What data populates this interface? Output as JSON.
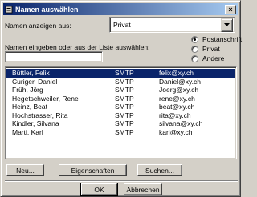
{
  "window": {
    "title": "Namen auswählen",
    "close_symbol": "×"
  },
  "show_names": {
    "label": "Namen anzeigen aus:",
    "selected": "Privat"
  },
  "search": {
    "label": "Namen eingeben oder aus der Liste auswählen:",
    "value": ""
  },
  "options": [
    {
      "label": "Postanschrift",
      "checked": true
    },
    {
      "label": "Privat",
      "checked": false
    },
    {
      "label": "Andere",
      "checked": false
    }
  ],
  "contacts": [
    {
      "name": "Büttler, Felix",
      "type": "SMTP",
      "email": "felix@xy.ch",
      "selected": true
    },
    {
      "name": "Curiger, Daniel",
      "type": "SMTP",
      "email": "Daniel@xy.ch",
      "selected": false
    },
    {
      "name": "Früh, Jörg",
      "type": "SMTP",
      "email": "Joerg@xy.ch",
      "selected": false
    },
    {
      "name": "Hegetschweiler, Rene",
      "type": "SMTP",
      "email": "rene@xy.ch",
      "selected": false
    },
    {
      "name": "Heinz, Beat",
      "type": "SMTP",
      "email": "beat@xy.ch",
      "selected": false
    },
    {
      "name": "Hochstrasser, Rita",
      "type": "SMTP",
      "email": "rita@xy.ch",
      "selected": false
    },
    {
      "name": "Kindler, Silvana",
      "type": "SMTP",
      "email": "silvana@xy.ch",
      "selected": false
    },
    {
      "name": "Marti, Karl",
      "type": "SMTP",
      "email": "karl@xy.ch",
      "selected": false
    }
  ],
  "buttons": {
    "new": "Neu...",
    "properties": "Eigenschaften",
    "search": "Suchen...",
    "ok": "OK",
    "cancel": "Abbrechen"
  },
  "colors": {
    "title_start": "#0a246a",
    "title_end": "#a6caf0",
    "selection": "#0a246a",
    "face": "#d4d0c8"
  }
}
